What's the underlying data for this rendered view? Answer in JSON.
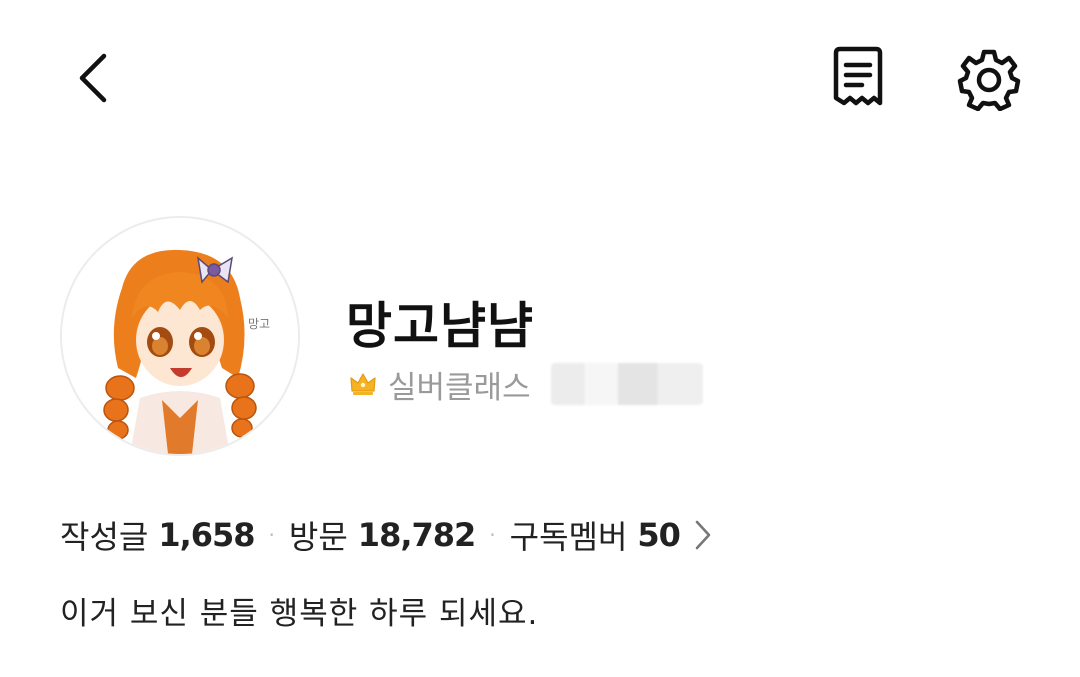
{
  "header": {
    "back_icon": "chevron-left-icon",
    "log_icon": "receipt-icon",
    "settings_icon": "gear-icon"
  },
  "profile": {
    "nickname": "망고냠냠",
    "grade_icon": "crown-icon",
    "grade_color": "#f5b324",
    "grade_label": "실버클래스"
  },
  "stats": {
    "posts_label": "작성글",
    "posts_value": "1,658",
    "visits_label": "방문",
    "visits_value": "18,782",
    "members_label": "구독멤버",
    "members_value": "50",
    "separator": "·"
  },
  "bio": "이거 보신 분들 행복한 하루 되세요."
}
